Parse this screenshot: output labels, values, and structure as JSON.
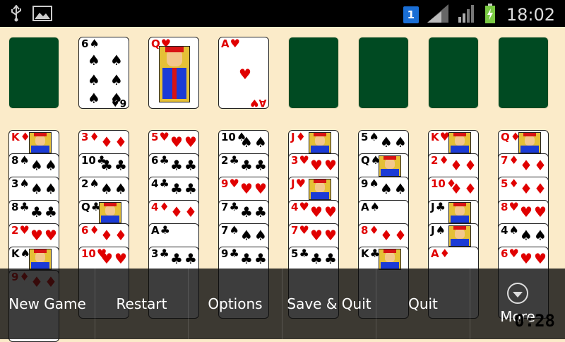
{
  "status_bar": {
    "time": "18:02",
    "sim_badge": "1",
    "left_icons": [
      "usb-icon",
      "image-icon"
    ],
    "right_icons": [
      "sim-badge-icon",
      "signal-icon",
      "signal-icon",
      "battery-charging-icon"
    ]
  },
  "game": {
    "timer": "0:28",
    "top_row": [
      {
        "type": "empty"
      },
      {
        "type": "card",
        "rank": "6",
        "suit": "♠",
        "color": "black"
      },
      {
        "type": "card",
        "rank": "Q",
        "suit": "♥",
        "color": "red",
        "face": true
      },
      {
        "type": "card",
        "rank": "A",
        "suit": "♥",
        "color": "red"
      },
      {
        "type": "empty"
      },
      {
        "type": "empty"
      },
      {
        "type": "empty"
      },
      {
        "type": "empty"
      }
    ],
    "columns": [
      [
        {
          "rank": "K",
          "suit": "♦",
          "color": "red"
        },
        {
          "rank": "8",
          "suit": "♠",
          "color": "black"
        },
        {
          "rank": "3",
          "suit": "♠",
          "color": "black"
        },
        {
          "rank": "8",
          "suit": "♣",
          "color": "black"
        },
        {
          "rank": "2",
          "suit": "♥",
          "color": "red"
        },
        {
          "rank": "K",
          "suit": "♠",
          "color": "black"
        },
        {
          "rank": "9",
          "suit": "♦",
          "color": "red"
        }
      ],
      [
        {
          "rank": "3",
          "suit": "♦",
          "color": "red"
        },
        {
          "rank": "10",
          "suit": "♣",
          "color": "black"
        },
        {
          "rank": "2",
          "suit": "♠",
          "color": "black"
        },
        {
          "rank": "Q",
          "suit": "♣",
          "color": "black"
        },
        {
          "rank": "6",
          "suit": "♦",
          "color": "red"
        },
        {
          "rank": "10",
          "suit": "♥",
          "color": "red"
        }
      ],
      [
        {
          "rank": "5",
          "suit": "♥",
          "color": "red"
        },
        {
          "rank": "6",
          "suit": "♣",
          "color": "black"
        },
        {
          "rank": "4",
          "suit": "♣",
          "color": "black"
        },
        {
          "rank": "4",
          "suit": "♦",
          "color": "red"
        },
        {
          "rank": "A",
          "suit": "♣",
          "color": "black"
        },
        {
          "rank": "3",
          "suit": "♣",
          "color": "black"
        }
      ],
      [
        {
          "rank": "10",
          "suit": "♠",
          "color": "black"
        },
        {
          "rank": "2",
          "suit": "♣",
          "color": "black"
        },
        {
          "rank": "9",
          "suit": "♥",
          "color": "red"
        },
        {
          "rank": "7",
          "suit": "♣",
          "color": "black"
        },
        {
          "rank": "7",
          "suit": "♠",
          "color": "black"
        },
        {
          "rank": "9",
          "suit": "♣",
          "color": "black"
        }
      ],
      [
        {
          "rank": "J",
          "suit": "♦",
          "color": "red"
        },
        {
          "rank": "3",
          "suit": "♥",
          "color": "red"
        },
        {
          "rank": "J",
          "suit": "♥",
          "color": "red"
        },
        {
          "rank": "4",
          "suit": "♥",
          "color": "red"
        },
        {
          "rank": "7",
          "suit": "♥",
          "color": "red"
        },
        {
          "rank": "5",
          "suit": "♣",
          "color": "black"
        }
      ],
      [
        {
          "rank": "5",
          "suit": "♠",
          "color": "black"
        },
        {
          "rank": "Q",
          "suit": "♠",
          "color": "black"
        },
        {
          "rank": "9",
          "suit": "♠",
          "color": "black"
        },
        {
          "rank": "A",
          "suit": "♠",
          "color": "black"
        },
        {
          "rank": "8",
          "suit": "♦",
          "color": "red"
        },
        {
          "rank": "K",
          "suit": "♣",
          "color": "black"
        }
      ],
      [
        {
          "rank": "K",
          "suit": "♥",
          "color": "red"
        },
        {
          "rank": "2",
          "suit": "♦",
          "color": "red"
        },
        {
          "rank": "10",
          "suit": "♦",
          "color": "red"
        },
        {
          "rank": "J",
          "suit": "♣",
          "color": "black"
        },
        {
          "rank": "J",
          "suit": "♠",
          "color": "black"
        },
        {
          "rank": "A",
          "suit": "♦",
          "color": "red"
        }
      ],
      [
        {
          "rank": "Q",
          "suit": "♦",
          "color": "red"
        },
        {
          "rank": "7",
          "suit": "♦",
          "color": "red"
        },
        {
          "rank": "5",
          "suit": "♦",
          "color": "red"
        },
        {
          "rank": "8",
          "suit": "♥",
          "color": "red"
        },
        {
          "rank": "4",
          "suit": "♠",
          "color": "black"
        },
        {
          "rank": "6",
          "suit": "♥",
          "color": "red"
        }
      ]
    ]
  },
  "menu": {
    "new_game": "New Game",
    "restart": "Restart",
    "options": "Options",
    "save_quit": "Save & Quit",
    "quit": "Quit",
    "more": "More"
  },
  "colors": {
    "felt": "#fbebc9",
    "slot_green": "#004a22",
    "red_suit": "#e00000",
    "menu_bg": "#0c0c0c"
  }
}
